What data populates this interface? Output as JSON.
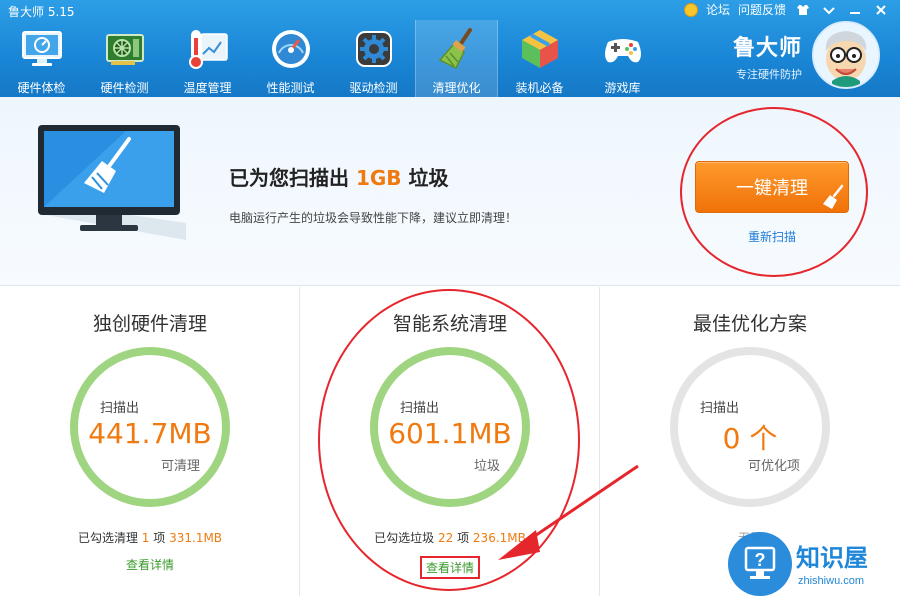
{
  "app": {
    "title": "鲁大师 5.15"
  },
  "top_links": {
    "forum": "论坛",
    "feedback": "问题反馈"
  },
  "nav": {
    "items": [
      {
        "label": "硬件体检"
      },
      {
        "label": "硬件检测"
      },
      {
        "label": "温度管理"
      },
      {
        "label": "性能测试"
      },
      {
        "label": "驱动检测"
      },
      {
        "label": "清理优化"
      },
      {
        "label": "装机必备"
      },
      {
        "label": "游戏库"
      }
    ],
    "active_index": 5
  },
  "brand": {
    "name": "鲁大师",
    "slogan": "专注硬件防护"
  },
  "summary": {
    "title_prefix": "已为您扫描出",
    "amount": "1GB",
    "title_suffix": "垃圾",
    "description": "电脑运行产生的垃圾会导致性能下降，建议立即清理！",
    "clean_button": "一键清理",
    "rescan": "重新扫描"
  },
  "panels": [
    {
      "title": "独创硬件清理",
      "ring_top": "扫描出",
      "value": "441.7MB",
      "unit": "可清理",
      "foot_prefix": "已勾选清理",
      "foot_count": "1",
      "foot_mid": "项",
      "foot_size": "331.1MB",
      "link": "查看详情"
    },
    {
      "title": "智能系统清理",
      "ring_top": "扫描出",
      "value": "601.1MB",
      "unit": "垃圾",
      "foot_prefix": "已勾选垃圾",
      "foot_count": "22",
      "foot_mid": "项",
      "foot_size": "236.1MB",
      "link": "查看详情"
    },
    {
      "title": "最佳优化方案",
      "ring_top": "扫描出",
      "value": "0 个",
      "unit": "可优化项",
      "foot_prefix": "无需",
      "link": ""
    }
  ],
  "watermark": {
    "name": "知识屋",
    "url": "zhishiwu.com"
  },
  "colors": {
    "header": "#1a86d6",
    "accent_orange": "#f07a10",
    "ring_green": "#9fd580",
    "annotation_red": "#e6262d",
    "link_green": "#3c9a2e"
  }
}
